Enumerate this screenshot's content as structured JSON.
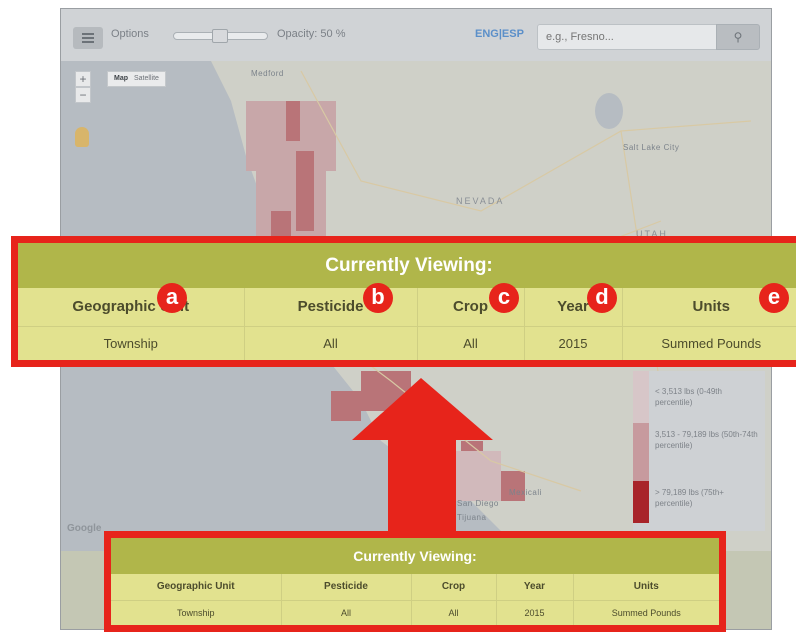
{
  "toolbar": {
    "options_label": "Options",
    "opacity_label": "Opacity: 50 %",
    "lang_label": "ENG|ESP",
    "search_placeholder": "e.g., Fresno...",
    "menu_icon": "hamburger-menu-icon",
    "search_icon": "search-icon"
  },
  "map": {
    "type_map": "Map",
    "type_satellite": "Satellite",
    "zoom_in": "+",
    "zoom_out": "−",
    "labels": {
      "medford": "Medford",
      "nevada": "NEVADA",
      "utah": "UTAH",
      "salt_lake_city": "Salt Lake City",
      "san_diego": "San Diego",
      "tijuana": "Tijuana",
      "mexicali": "Mexicali",
      "google": "Google"
    }
  },
  "legend": {
    "items": [
      {
        "label": "< 3,513 lbs (0-49th percentile)",
        "color": "#d7c6c8"
      },
      {
        "label": "3,513 - 79,189 lbs (50th-74th percentile)",
        "color": "#c79a9e"
      },
      {
        "label": "> 79,189 lbs (75th+ percentile)",
        "color": "#a8242a"
      }
    ]
  },
  "viewing": {
    "title": "Currently Viewing:",
    "columns": [
      "Geographic Unit",
      "Pesticide",
      "Crop",
      "Year",
      "Units"
    ],
    "values": [
      "Township",
      "All",
      "All",
      "2015",
      "Summed Pounds"
    ]
  },
  "annotations": {
    "badges": [
      "a",
      "b",
      "c",
      "d",
      "e"
    ],
    "accent_color": "#e7241b",
    "panel_color": "#e2e28f",
    "title_bar_color": "#b0b64a"
  }
}
